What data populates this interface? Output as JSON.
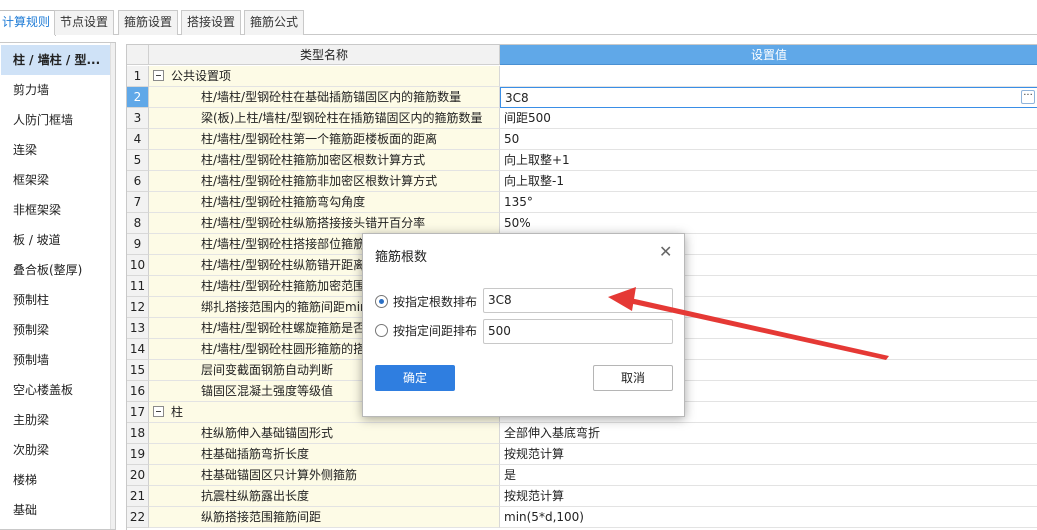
{
  "tabs": [
    {
      "label": "计算规则",
      "active": true
    },
    {
      "label": "节点设置",
      "active": false
    },
    {
      "label": "箍筋设置",
      "active": false
    },
    {
      "label": "搭接设置",
      "active": false
    },
    {
      "label": "箍筋公式",
      "active": false
    }
  ],
  "sidebar": {
    "items": [
      {
        "label": "柱 / 墙柱 / 型...",
        "active": true
      },
      {
        "label": "剪力墙"
      },
      {
        "label": "人防门框墙"
      },
      {
        "label": "连梁"
      },
      {
        "label": "框架梁"
      },
      {
        "label": "非框架梁"
      },
      {
        "label": "板 / 坡道"
      },
      {
        "label": "叠合板(整厚)"
      },
      {
        "label": "预制柱"
      },
      {
        "label": "预制梁"
      },
      {
        "label": "预制墙"
      },
      {
        "label": "空心楼盖板"
      },
      {
        "label": "主肋梁"
      },
      {
        "label": "次肋梁"
      },
      {
        "label": "楼梯"
      },
      {
        "label": "基础"
      }
    ]
  },
  "grid": {
    "header_type": "类型名称",
    "header_value": "设置值",
    "rows": [
      {
        "num": "1",
        "type": "公共设置项",
        "value": "",
        "group": true
      },
      {
        "num": "2",
        "type": "柱/墙柱/型钢砼柱在基础插筋锚固区内的箍筋数量",
        "value": "3C8",
        "selected": true
      },
      {
        "num": "3",
        "type": "梁(板)上柱/墙柱/型钢砼柱在插筋锚固区内的箍筋数量",
        "value": "间距500"
      },
      {
        "num": "4",
        "type": "柱/墙柱/型钢砼柱第一个箍筋距楼板面的距离",
        "value": "50"
      },
      {
        "num": "5",
        "type": "柱/墙柱/型钢砼柱箍筋加密区根数计算方式",
        "value": "向上取整+1"
      },
      {
        "num": "6",
        "type": "柱/墙柱/型钢砼柱箍筋非加密区根数计算方式",
        "value": "向上取整-1"
      },
      {
        "num": "7",
        "type": "柱/墙柱/型钢砼柱箍筋弯勾角度",
        "value": "135°"
      },
      {
        "num": "8",
        "type": "柱/墙柱/型钢砼柱纵筋搭接接头错开百分率",
        "value": "50%"
      },
      {
        "num": "9",
        "type": "柱/墙柱/型钢砼柱搭接部位箍筋加密",
        "value": ""
      },
      {
        "num": "10",
        "type": "柱/墙柱/型钢砼柱纵筋错开距离设置",
        "value": ""
      },
      {
        "num": "11",
        "type": "柱/墙柱/型钢砼柱箍筋加密范围包含",
        "value": ""
      },
      {
        "num": "12",
        "type": "绑扎搭接范围内的箍筋间距min(5d",
        "value": ""
      },
      {
        "num": "13",
        "type": "柱/墙柱/型钢砼柱螺旋箍筋是否连续",
        "value": ""
      },
      {
        "num": "14",
        "type": "柱/墙柱/型钢砼柱圆形箍筋的搭接长",
        "value": ""
      },
      {
        "num": "15",
        "type": "层间变截面钢筋自动判断",
        "value": ""
      },
      {
        "num": "16",
        "type": "锚固区混凝土强度等级值",
        "value": ""
      },
      {
        "num": "17",
        "type": "柱",
        "value": "",
        "group": true
      },
      {
        "num": "18",
        "type": "柱纵筋伸入基础锚固形式",
        "value": "全部伸入基底弯折"
      },
      {
        "num": "19",
        "type": "柱基础插筋弯折长度",
        "value": "按规范计算"
      },
      {
        "num": "20",
        "type": "柱基础锚固区只计算外侧箍筋",
        "value": "是"
      },
      {
        "num": "21",
        "type": "抗震柱纵筋露出长度",
        "value": "按规范计算"
      },
      {
        "num": "22",
        "type": "纵筋搭接范围箍筋间距",
        "value": "min(5*d,100)"
      }
    ]
  },
  "dialog": {
    "title": "箍筋根数",
    "close_symbol": "✕",
    "option_count_label": "按指定根数排布",
    "option_count_value": "3C8",
    "option_spacing_label": "按指定间距排布",
    "option_spacing_value": "500",
    "ok_label": "确定",
    "cancel_label": "取消"
  },
  "ellipsis": "···",
  "colors": {
    "accent": "#60a8e8",
    "selected_row": "#cfe2f7",
    "type_column_bg": "#fdfbe6",
    "arrow": "#e53935"
  }
}
